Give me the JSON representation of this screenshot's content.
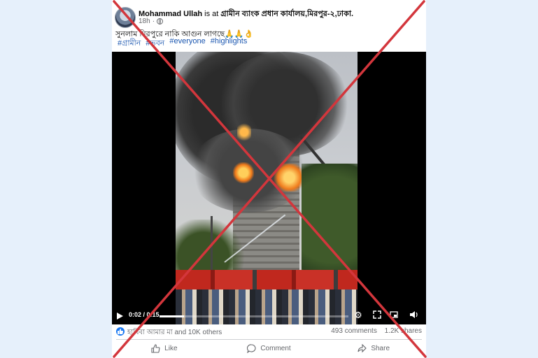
{
  "post": {
    "author": "Mohammad Ullah",
    "is_at": "is at",
    "location": "গ্রামীন ব্যাংক প্রধান কার্যালয়,মিরপুর-২,ঢাকা.",
    "time": "18h",
    "text": "সুনলাম মিরপুরে নাকি আগুন লাগছে🙏🙏👌",
    "hashtags": [
      "#গ্রামীন",
      "#ভবন",
      "#everyone",
      "#highlights"
    ]
  },
  "video": {
    "time_display": "0:02 / 0:15",
    "progress": 0.13
  },
  "reactions": {
    "text": "হাবিবা আমার মা and 10K others",
    "comments": "493 comments",
    "shares": "1.2K shares"
  },
  "actions": {
    "like": "Like",
    "comment": "Comment",
    "share": "Share"
  },
  "colors": {
    "background": "#e6f0fb",
    "link": "#1a56b0",
    "cross": "#d3363c"
  }
}
